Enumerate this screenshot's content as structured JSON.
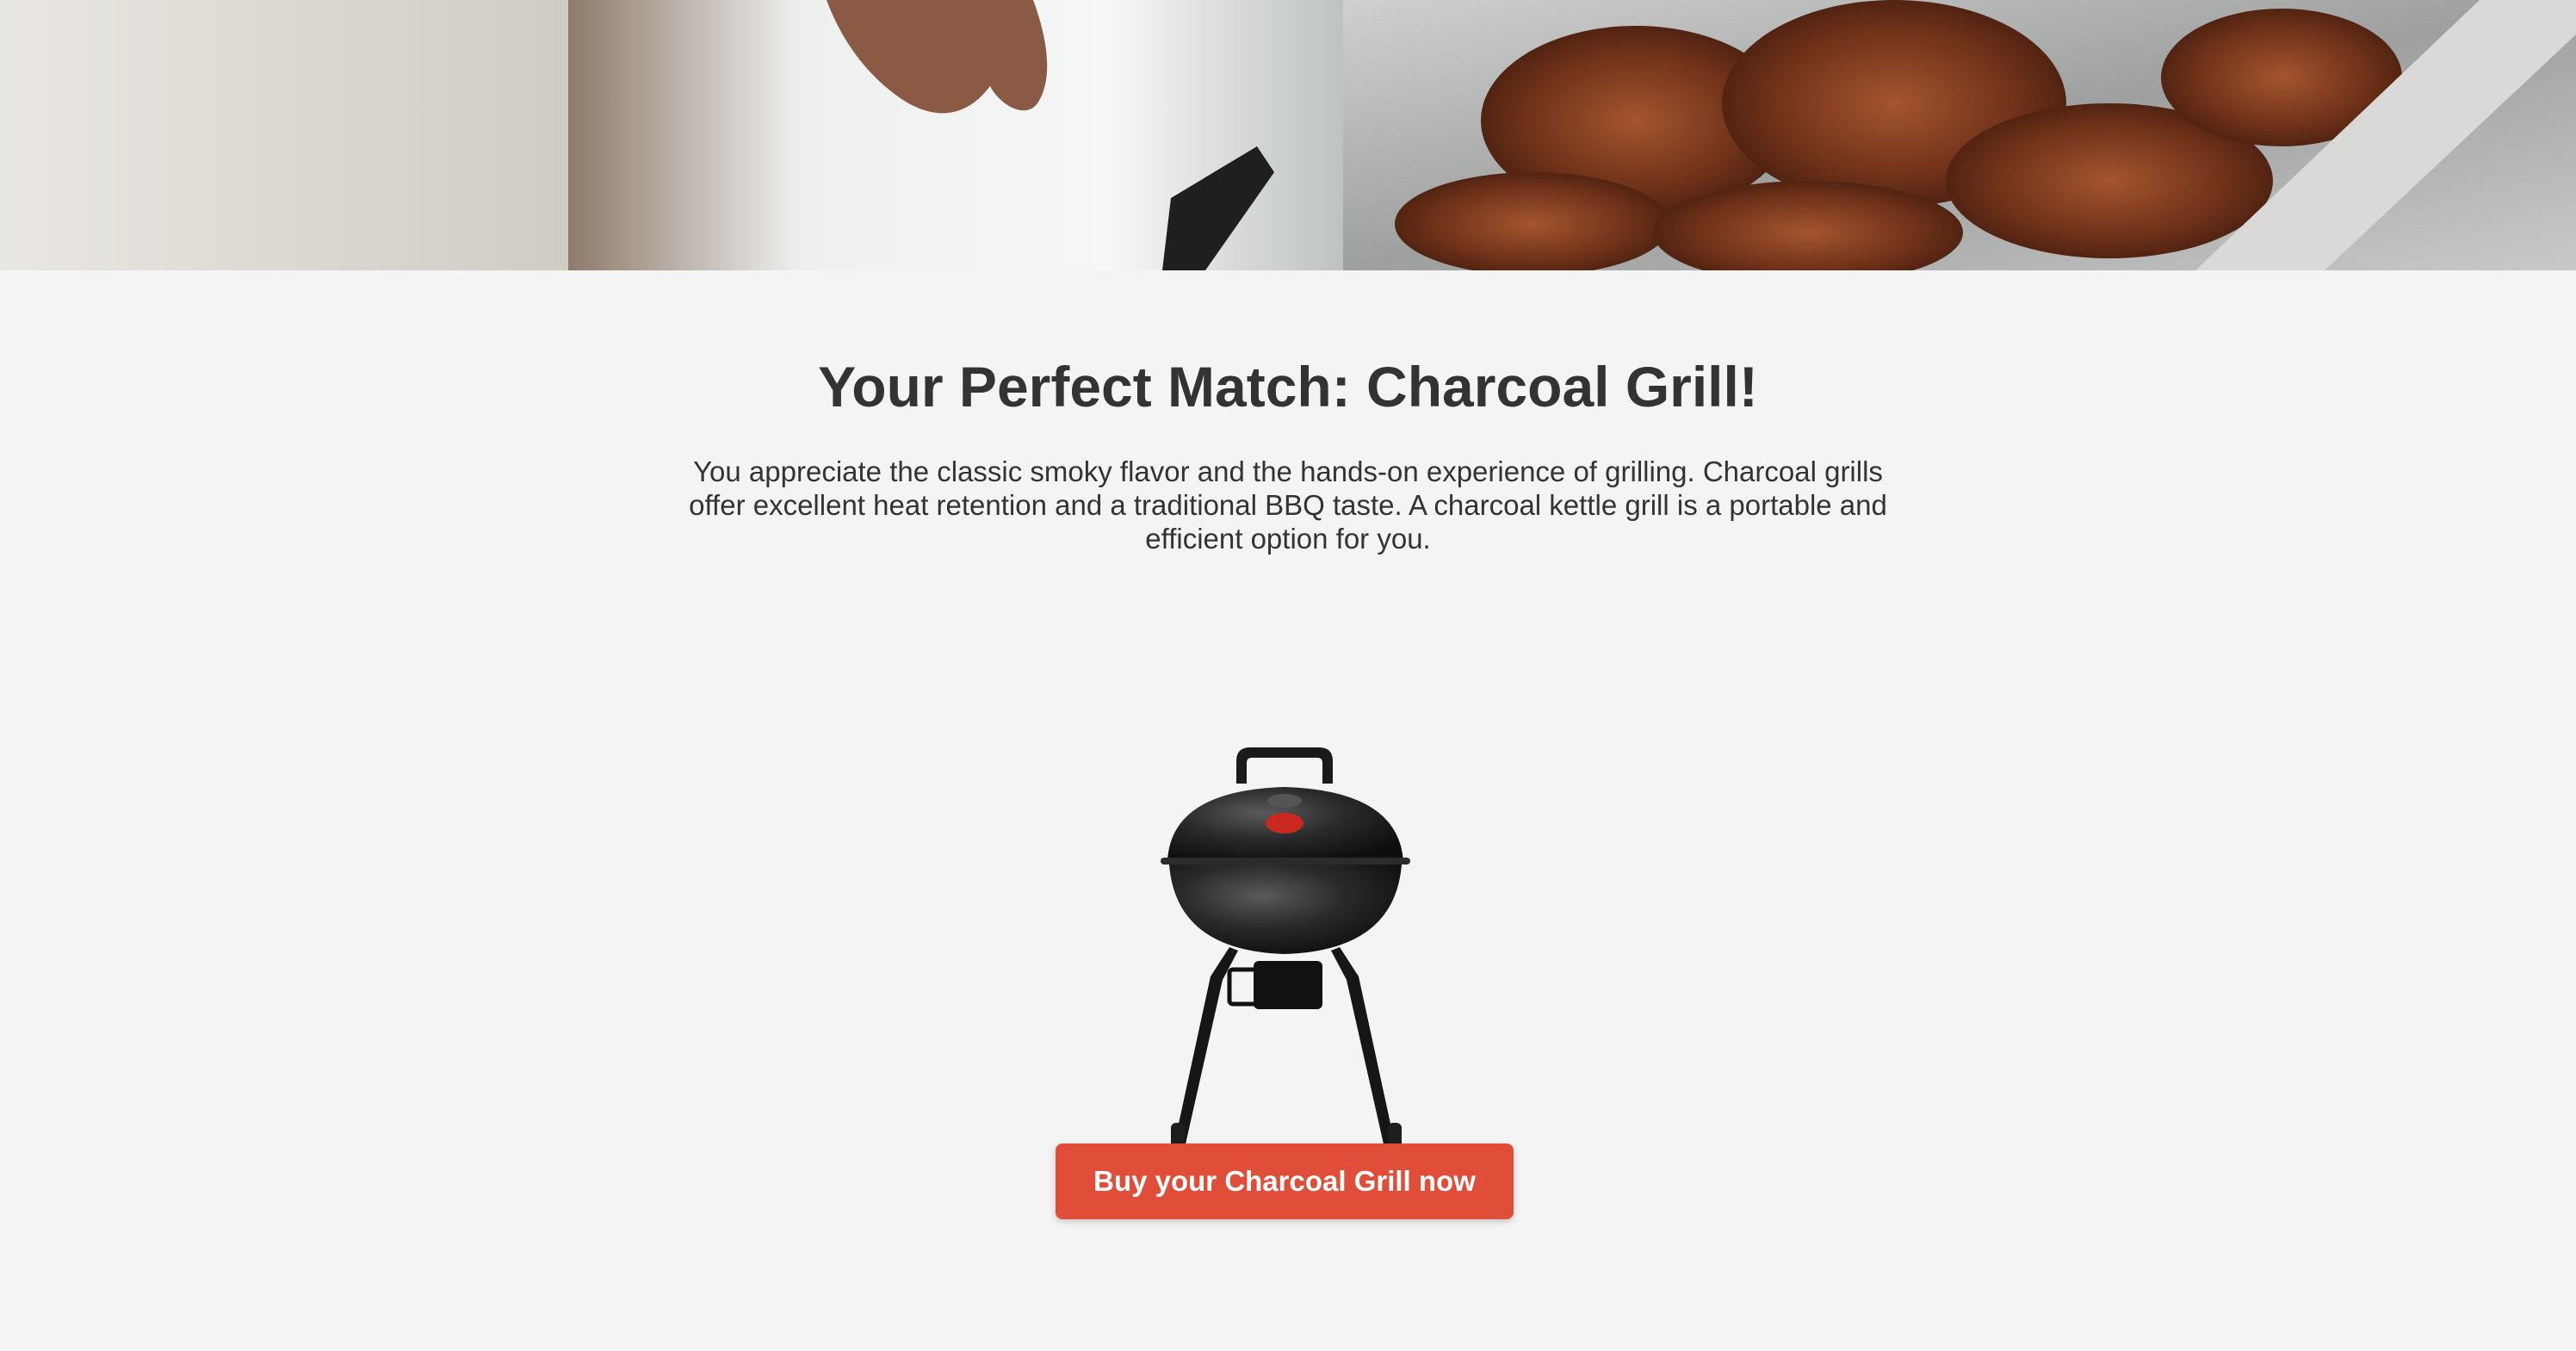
{
  "hero": {
    "image": "barbecue-meat-grilling-photo"
  },
  "result": {
    "title": "Your Perfect Match: Charcoal Grill!",
    "description": "You appreciate the classic smoky flavor and the hands-on experience of grilling. Charcoal grills offer excellent heat retention and a traditional BBQ taste. A charcoal kettle grill is a portable and efficient option for you.",
    "product_image": "charcoal-kettle-grill",
    "cta_label": "Buy your Charcoal Grill now"
  },
  "colors": {
    "background": "#f4f4f4",
    "text": "#333333",
    "cta": "#e04e39",
    "cta_text": "#ffffff"
  }
}
